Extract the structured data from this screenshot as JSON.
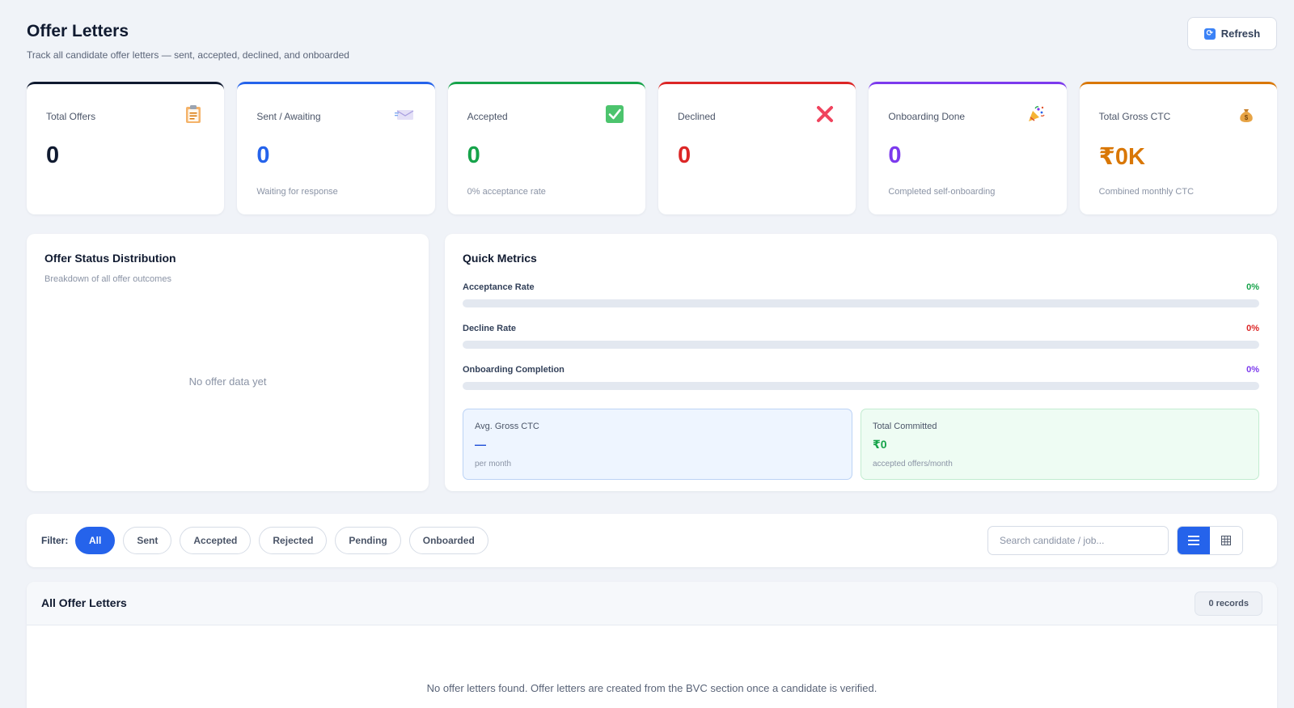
{
  "header": {
    "title": "Offer Letters",
    "subtitle": "Track all candidate offer letters — sent, accepted, declined, and onboarded",
    "refresh_label": "Refresh"
  },
  "cards": [
    {
      "label": "Total Offers",
      "value": "0",
      "note": "",
      "icon": "clipboard-icon",
      "accent": "#101a30"
    },
    {
      "label": "Sent / Awaiting",
      "value": "0",
      "note": "Waiting for response",
      "icon": "envelope-icon",
      "accent": "#2563eb"
    },
    {
      "label": "Accepted",
      "value": "0",
      "note": "0% acceptance rate",
      "icon": "check-icon",
      "accent": "#16a34a"
    },
    {
      "label": "Declined",
      "value": "0",
      "note": "",
      "icon": "cross-icon",
      "accent": "#dc2626"
    },
    {
      "label": "Onboarding Done",
      "value": "0",
      "note": "Completed self-onboarding",
      "icon": "party-popper-icon",
      "accent": "#7c3aed"
    },
    {
      "label": "Total Gross CTC",
      "value": "₹0K",
      "note": "Combined monthly CTC",
      "icon": "money-bag-icon",
      "accent": "#d97706"
    }
  ],
  "distribution": {
    "title": "Offer Status Distribution",
    "subtitle": "Breakdown of all offer outcomes",
    "empty": "No offer data yet"
  },
  "metrics": {
    "title": "Quick Metrics",
    "rows": [
      {
        "name": "Acceptance Rate",
        "value": "0%",
        "percent": 0,
        "color": "#16a34a"
      },
      {
        "name": "Decline Rate",
        "value": "0%",
        "percent": 0,
        "color": "#dc2626"
      },
      {
        "name": "Onboarding Completion",
        "value": "0%",
        "percent": 0,
        "color": "#7c3aed"
      }
    ],
    "avg_ctc": {
      "label": "Avg. Gross CTC",
      "value": "—",
      "note": "per month",
      "color": "#1d4ed8"
    },
    "total_committed": {
      "label": "Total Committed",
      "value": "₹0",
      "note": "accepted offers/month",
      "color": "#16a34a"
    }
  },
  "filters": {
    "label": "Filter:",
    "chips": [
      "All",
      "Sent",
      "Accepted",
      "Rejected",
      "Pending",
      "Onboarded"
    ],
    "active": "All",
    "search_placeholder": "Search candidate / job..."
  },
  "table": {
    "title": "All Offer Letters",
    "records": "0 records",
    "empty": "No offer letters found. Offer letters are created from the BVC section once a candidate is verified."
  }
}
